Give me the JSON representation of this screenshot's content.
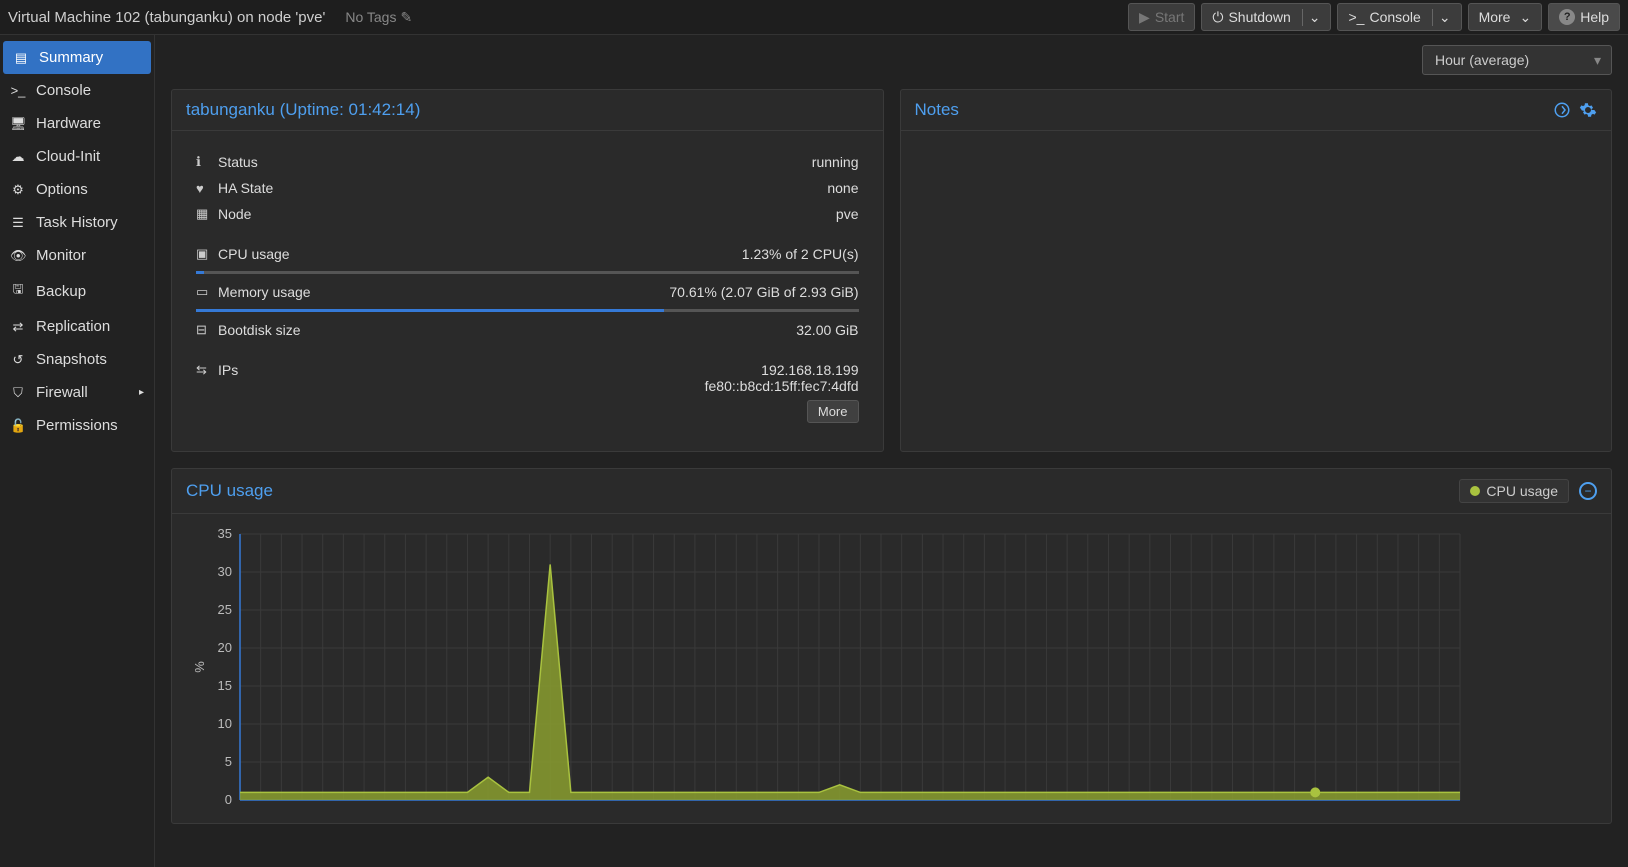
{
  "header": {
    "title": "Virtual Machine 102 (tabunganku) on node 'pve'",
    "notags": "No Tags",
    "btn_start": "Start",
    "btn_shutdown": "Shutdown",
    "btn_console": "Console",
    "btn_more": "More",
    "btn_help": "Help"
  },
  "sidebar": {
    "items": [
      {
        "label": "Summary"
      },
      {
        "label": "Console"
      },
      {
        "label": "Hardware"
      },
      {
        "label": "Cloud-Init"
      },
      {
        "label": "Options"
      },
      {
        "label": "Task History"
      },
      {
        "label": "Monitor"
      },
      {
        "label": "Backup"
      },
      {
        "label": "Replication"
      },
      {
        "label": "Snapshots"
      },
      {
        "label": "Firewall"
      },
      {
        "label": "Permissions"
      }
    ]
  },
  "timeframe": "Hour (average)",
  "summary": {
    "title": "tabunganku (Uptime: 01:42:14)",
    "status_label": "Status",
    "status_value": "running",
    "ha_label": "HA State",
    "ha_value": "none",
    "node_label": "Node",
    "node_value": "pve",
    "cpu_label": "CPU usage",
    "cpu_value": "1.23% of 2 CPU(s)",
    "cpu_percent": 1.23,
    "mem_label": "Memory usage",
    "mem_value": "70.61% (2.07 GiB of 2.93 GiB)",
    "mem_percent": 70.61,
    "disk_label": "Bootdisk size",
    "disk_value": "32.00 GiB",
    "ips_label": "IPs",
    "ips_value1": "192.168.18.199",
    "ips_value2": "fe80::b8cd:15ff:fec7:4dfd",
    "more": "More"
  },
  "notes": {
    "title": "Notes"
  },
  "chart": {
    "title": "CPU usage",
    "legend": "CPU usage",
    "ylabel": "%"
  },
  "chart_data": {
    "type": "area",
    "ylabel": "%",
    "ylim": [
      0,
      35
    ],
    "yticks": [
      0,
      5,
      10,
      15,
      20,
      25,
      30,
      35
    ],
    "series": [
      {
        "name": "CPU usage",
        "values": [
          1,
          1,
          1,
          1,
          1,
          1,
          1,
          1,
          1,
          1,
          1,
          1,
          3,
          1,
          1,
          31,
          1,
          1,
          1,
          1,
          1,
          1,
          1,
          1,
          1,
          1,
          1,
          1,
          1,
          2,
          1,
          1,
          1,
          1,
          1,
          1,
          1,
          1,
          1,
          1,
          1,
          1,
          1,
          1,
          1,
          1,
          1,
          1,
          1,
          1,
          1,
          1,
          1,
          1,
          1,
          1,
          1,
          1,
          1,
          1
        ]
      }
    ],
    "marker_index": 52
  }
}
